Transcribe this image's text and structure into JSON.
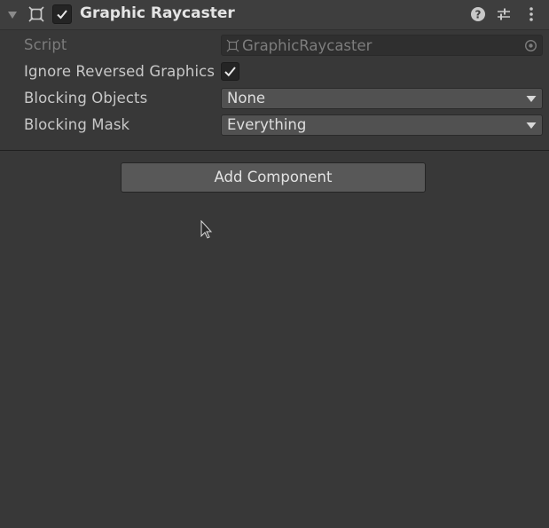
{
  "component": {
    "title": "Graphic Raycaster",
    "enabled": true,
    "icons": {
      "foldout": "triangle-down-icon",
      "component": "rect-transform-icon",
      "help": "help-icon",
      "presets": "sliders-icon",
      "menu": "kebab-menu-icon"
    }
  },
  "properties": {
    "script": {
      "label": "Script",
      "value": "GraphicRaycaster",
      "icon": "script-icon",
      "picker_icon": "object-picker-icon"
    },
    "ignore_reversed": {
      "label": "Ignore Reversed Graphics",
      "checked": true
    },
    "blocking_objects": {
      "label": "Blocking Objects",
      "value": "None"
    },
    "blocking_mask": {
      "label": "Blocking Mask",
      "value": "Everything"
    }
  },
  "footer": {
    "add_component_label": "Add Component"
  },
  "colors": {
    "background": "#383838",
    "header": "#3e3e3e",
    "dropdown": "#515151",
    "button": "#585858",
    "text": "#c8c8c8",
    "disabled_text": "#7c7c7c"
  }
}
